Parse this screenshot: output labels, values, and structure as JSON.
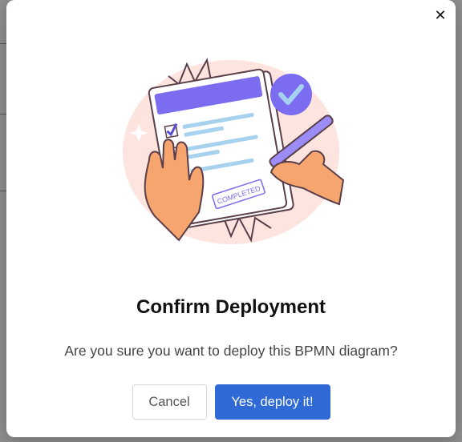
{
  "modal": {
    "title": "Confirm Deployment",
    "message": "Are you sure you want to deploy this BPMN diagram?",
    "close_glyph": "✕",
    "cancel_label": "Cancel",
    "confirm_label": "Yes, deploy it!",
    "stamp_text": "COMPLETED"
  },
  "colors": {
    "accent": "#2f6ad6",
    "illustration_purple": "#7b6cf0",
    "illustration_bg": "#fde4df"
  }
}
